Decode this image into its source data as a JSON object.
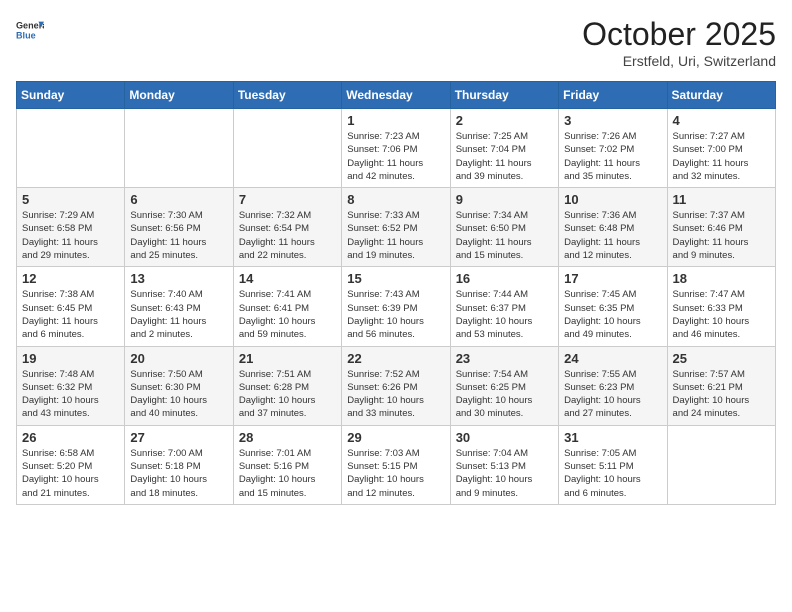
{
  "header": {
    "logo_general": "General",
    "logo_blue": "Blue",
    "month": "October 2025",
    "location": "Erstfeld, Uri, Switzerland"
  },
  "weekdays": [
    "Sunday",
    "Monday",
    "Tuesday",
    "Wednesday",
    "Thursday",
    "Friday",
    "Saturday"
  ],
  "weeks": [
    [
      {
        "day": "",
        "info": ""
      },
      {
        "day": "",
        "info": ""
      },
      {
        "day": "",
        "info": ""
      },
      {
        "day": "1",
        "info": "Sunrise: 7:23 AM\nSunset: 7:06 PM\nDaylight: 11 hours\nand 42 minutes."
      },
      {
        "day": "2",
        "info": "Sunrise: 7:25 AM\nSunset: 7:04 PM\nDaylight: 11 hours\nand 39 minutes."
      },
      {
        "day": "3",
        "info": "Sunrise: 7:26 AM\nSunset: 7:02 PM\nDaylight: 11 hours\nand 35 minutes."
      },
      {
        "day": "4",
        "info": "Sunrise: 7:27 AM\nSunset: 7:00 PM\nDaylight: 11 hours\nand 32 minutes."
      }
    ],
    [
      {
        "day": "5",
        "info": "Sunrise: 7:29 AM\nSunset: 6:58 PM\nDaylight: 11 hours\nand 29 minutes."
      },
      {
        "day": "6",
        "info": "Sunrise: 7:30 AM\nSunset: 6:56 PM\nDaylight: 11 hours\nand 25 minutes."
      },
      {
        "day": "7",
        "info": "Sunrise: 7:32 AM\nSunset: 6:54 PM\nDaylight: 11 hours\nand 22 minutes."
      },
      {
        "day": "8",
        "info": "Sunrise: 7:33 AM\nSunset: 6:52 PM\nDaylight: 11 hours\nand 19 minutes."
      },
      {
        "day": "9",
        "info": "Sunrise: 7:34 AM\nSunset: 6:50 PM\nDaylight: 11 hours\nand 15 minutes."
      },
      {
        "day": "10",
        "info": "Sunrise: 7:36 AM\nSunset: 6:48 PM\nDaylight: 11 hours\nand 12 minutes."
      },
      {
        "day": "11",
        "info": "Sunrise: 7:37 AM\nSunset: 6:46 PM\nDaylight: 11 hours\nand 9 minutes."
      }
    ],
    [
      {
        "day": "12",
        "info": "Sunrise: 7:38 AM\nSunset: 6:45 PM\nDaylight: 11 hours\nand 6 minutes."
      },
      {
        "day": "13",
        "info": "Sunrise: 7:40 AM\nSunset: 6:43 PM\nDaylight: 11 hours\nand 2 minutes."
      },
      {
        "day": "14",
        "info": "Sunrise: 7:41 AM\nSunset: 6:41 PM\nDaylight: 10 hours\nand 59 minutes."
      },
      {
        "day": "15",
        "info": "Sunrise: 7:43 AM\nSunset: 6:39 PM\nDaylight: 10 hours\nand 56 minutes."
      },
      {
        "day": "16",
        "info": "Sunrise: 7:44 AM\nSunset: 6:37 PM\nDaylight: 10 hours\nand 53 minutes."
      },
      {
        "day": "17",
        "info": "Sunrise: 7:45 AM\nSunset: 6:35 PM\nDaylight: 10 hours\nand 49 minutes."
      },
      {
        "day": "18",
        "info": "Sunrise: 7:47 AM\nSunset: 6:33 PM\nDaylight: 10 hours\nand 46 minutes."
      }
    ],
    [
      {
        "day": "19",
        "info": "Sunrise: 7:48 AM\nSunset: 6:32 PM\nDaylight: 10 hours\nand 43 minutes."
      },
      {
        "day": "20",
        "info": "Sunrise: 7:50 AM\nSunset: 6:30 PM\nDaylight: 10 hours\nand 40 minutes."
      },
      {
        "day": "21",
        "info": "Sunrise: 7:51 AM\nSunset: 6:28 PM\nDaylight: 10 hours\nand 37 minutes."
      },
      {
        "day": "22",
        "info": "Sunrise: 7:52 AM\nSunset: 6:26 PM\nDaylight: 10 hours\nand 33 minutes."
      },
      {
        "day": "23",
        "info": "Sunrise: 7:54 AM\nSunset: 6:25 PM\nDaylight: 10 hours\nand 30 minutes."
      },
      {
        "day": "24",
        "info": "Sunrise: 7:55 AM\nSunset: 6:23 PM\nDaylight: 10 hours\nand 27 minutes."
      },
      {
        "day": "25",
        "info": "Sunrise: 7:57 AM\nSunset: 6:21 PM\nDaylight: 10 hours\nand 24 minutes."
      }
    ],
    [
      {
        "day": "26",
        "info": "Sunrise: 6:58 AM\nSunset: 5:20 PM\nDaylight: 10 hours\nand 21 minutes."
      },
      {
        "day": "27",
        "info": "Sunrise: 7:00 AM\nSunset: 5:18 PM\nDaylight: 10 hours\nand 18 minutes."
      },
      {
        "day": "28",
        "info": "Sunrise: 7:01 AM\nSunset: 5:16 PM\nDaylight: 10 hours\nand 15 minutes."
      },
      {
        "day": "29",
        "info": "Sunrise: 7:03 AM\nSunset: 5:15 PM\nDaylight: 10 hours\nand 12 minutes."
      },
      {
        "day": "30",
        "info": "Sunrise: 7:04 AM\nSunset: 5:13 PM\nDaylight: 10 hours\nand 9 minutes."
      },
      {
        "day": "31",
        "info": "Sunrise: 7:05 AM\nSunset: 5:11 PM\nDaylight: 10 hours\nand 6 minutes."
      },
      {
        "day": "",
        "info": ""
      }
    ]
  ]
}
